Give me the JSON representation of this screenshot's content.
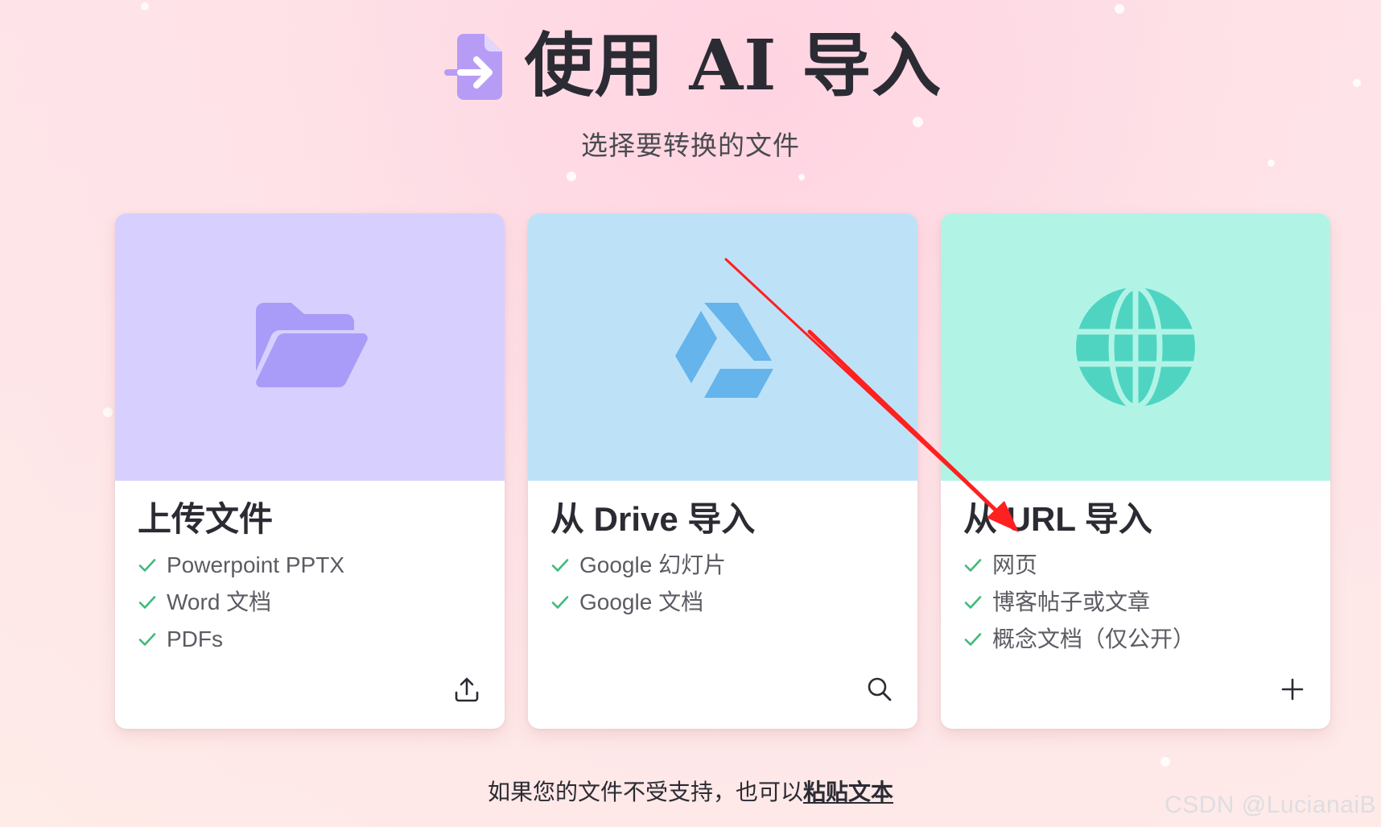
{
  "header": {
    "title": "使用 AI 导入",
    "subtitle": "选择要转换的文件",
    "icon": "file-import-icon"
  },
  "cards": [
    {
      "title": "上传文件",
      "hero_icon": "folder-open-icon",
      "hero_color": "#d7cffd",
      "icon_color": "#a89cf8",
      "features": [
        "Powerpoint PPTX",
        "Word 文档",
        "PDFs"
      ],
      "action_icon": "upload-icon"
    },
    {
      "title": "从 Drive 导入",
      "hero_icon": "google-drive-icon",
      "hero_color": "#bde2f8",
      "icon_color": "#65b4ec",
      "features": [
        "Google 幻灯片",
        "Google 文档"
      ],
      "action_icon": "search-icon"
    },
    {
      "title": "从 URL 导入",
      "hero_icon": "globe-icon",
      "hero_color": "#b1f4e6",
      "icon_color": "#4fd4c2",
      "features": [
        "网页",
        "博客帖子或文章",
        "概念文档（仅公开）"
      ],
      "action_icon": "plus-icon"
    }
  ],
  "footer": {
    "text": "如果您的文件不受支持，也可以",
    "link": "粘贴文本"
  },
  "watermark": "CSDN @LucianaiB",
  "colors": {
    "check": "#3fb97c",
    "annotation_arrow": "#ff2020"
  }
}
